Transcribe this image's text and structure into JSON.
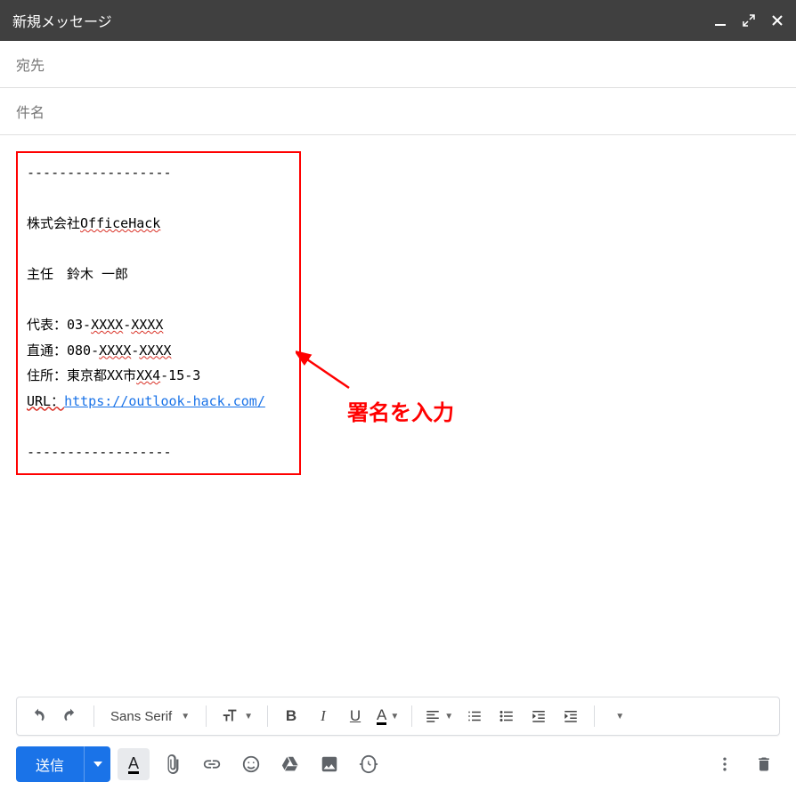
{
  "header": {
    "title": "新規メッセージ"
  },
  "fields": {
    "to_label": "宛先",
    "subject_label": "件名"
  },
  "signature": {
    "separator_top": "------------------",
    "company": "株式会社OfficeHack",
    "company_plain": "株式会社",
    "company_spell": "OfficeHack",
    "role_name": "主任　鈴木 一郎",
    "tel1_label": "代表：03-",
    "tel1_a": "XXXX",
    "tel1_dash": "-",
    "tel1_b": "XXXX",
    "tel2_label": "直通：080-",
    "tel2_a": "XXXX",
    "tel2_dash": "-",
    "tel2_b": "XXXX",
    "addr_label": "住所：東京都XX市",
    "addr_spell": "XX4",
    "addr_tail": "-15-3",
    "url_prefix": "URL：",
    "url": "https://outlook-hack.com/",
    "separator_bottom": "------------------"
  },
  "annotation": {
    "text": "署名を入力"
  },
  "format_toolbar": {
    "font": "Sans Serif"
  },
  "bottom": {
    "send_label": "送信"
  }
}
